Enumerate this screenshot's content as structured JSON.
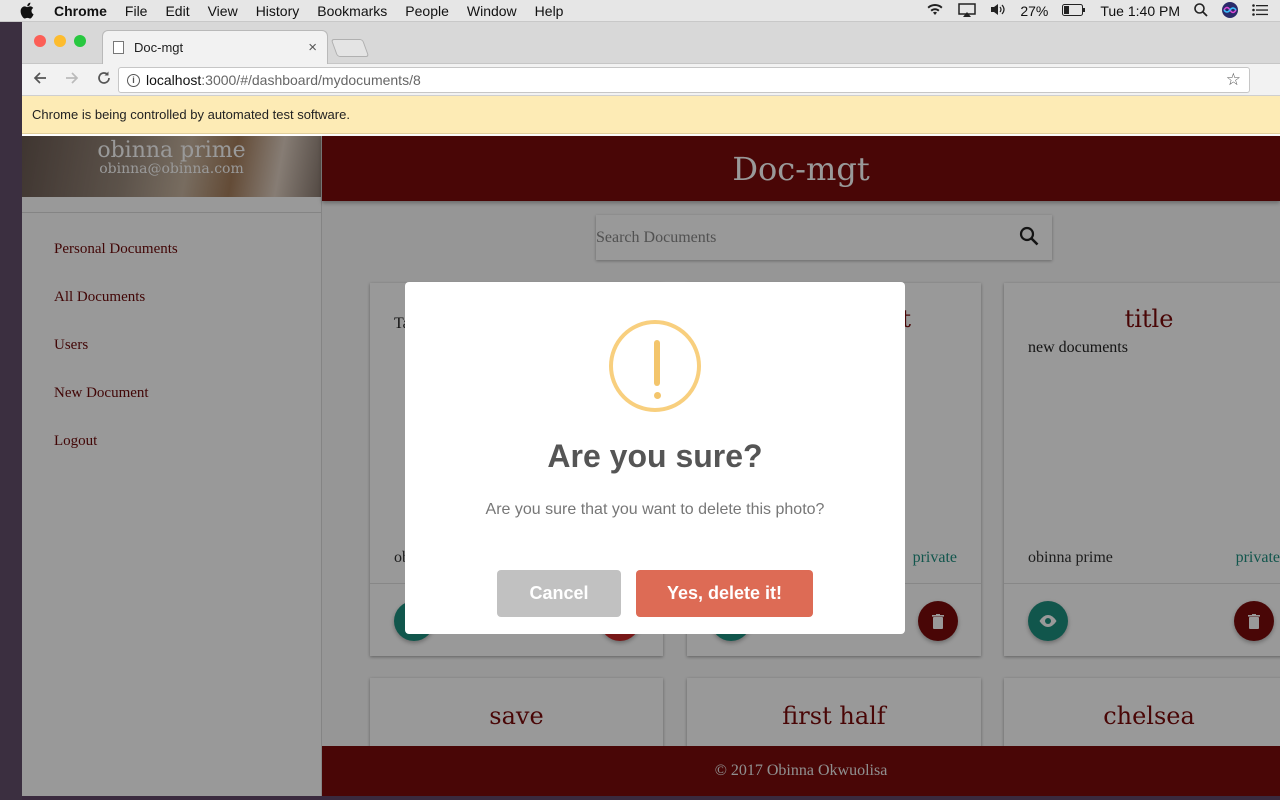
{
  "menubar": {
    "app": "Chrome",
    "items": [
      "File",
      "Edit",
      "View",
      "History",
      "Bookmarks",
      "People",
      "Window",
      "Help"
    ],
    "battery": "27%",
    "clock": "Tue 1:40 PM"
  },
  "browser": {
    "tab_title": "Doc-mgt",
    "url_host": "localhost",
    "url_path": ":3000/#/dashboard/mydocuments/8",
    "infobar": "Chrome is being controlled by automated test software."
  },
  "sidebar": {
    "user_name": "obinna prime",
    "user_email": "obinna@obinna.com",
    "items": [
      {
        "label": "Personal Documents"
      },
      {
        "label": "All Documents"
      },
      {
        "label": "Users"
      },
      {
        "label": "New Document"
      },
      {
        "label": "Logout"
      }
    ]
  },
  "header": {
    "title": "Doc-mgt"
  },
  "search": {
    "placeholder": "Search Documents"
  },
  "cards": [
    {
      "title": "",
      "body": "Ta",
      "owner": "ob",
      "access": ""
    },
    {
      "title": "t",
      "body": "",
      "owner": "",
      "access": "private"
    },
    {
      "title": "title",
      "body": "new documents",
      "owner": "obinna prime",
      "access": "private"
    },
    {
      "title": "save"
    },
    {
      "title": "first half"
    },
    {
      "title": "chelsea"
    }
  ],
  "footer": {
    "text": "© 2017 Obinna Okwuolisa"
  },
  "dialog": {
    "title": "Are you sure?",
    "text": "Are you sure that you want to delete this photo?",
    "cancel": "Cancel",
    "confirm": "Yes, delete it!"
  },
  "colors": {
    "brand": "#7a0b0b",
    "accent": "#1d8f7f",
    "warning": "#f8cf7e",
    "confirm": "#dd6b55"
  }
}
